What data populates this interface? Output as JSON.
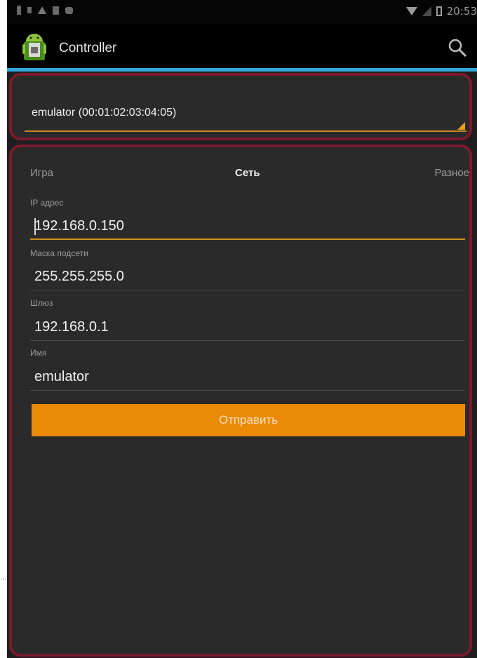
{
  "status_bar": {
    "time": "20:53",
    "left_icons": [
      "usb-icon",
      "notification-icon",
      "warning-icon",
      "sd-card-icon",
      "download-icon"
    ],
    "right_icons": [
      "wifi-icon",
      "signal-icon",
      "battery-icon"
    ]
  },
  "action_bar": {
    "title": "Controller",
    "icon": "android-icon",
    "action_icon": "search-icon"
  },
  "device_selector": {
    "selected": "emulator (00:01:02:03:04:05)"
  },
  "tabs": [
    {
      "label": "Игра",
      "active": false
    },
    {
      "label": "Сеть",
      "active": true
    },
    {
      "label": "Разное",
      "active": false
    }
  ],
  "form": {
    "ip_label": "IP адрес",
    "ip_value": "192.168.0.150",
    "mask_label": "Маска подсети",
    "mask_value": "255.255.255.0",
    "gateway_label": "Шлюз",
    "gateway_value": "192.168.0.1",
    "name_label": "Имя",
    "name_value": "emulator",
    "submit_label": "Отправить"
  },
  "colors": {
    "accent_blue": "#33a9d9",
    "panel_border": "#7a1b2b",
    "button_orange": "#ea8a07",
    "focus_underline": "#d28f1a"
  }
}
